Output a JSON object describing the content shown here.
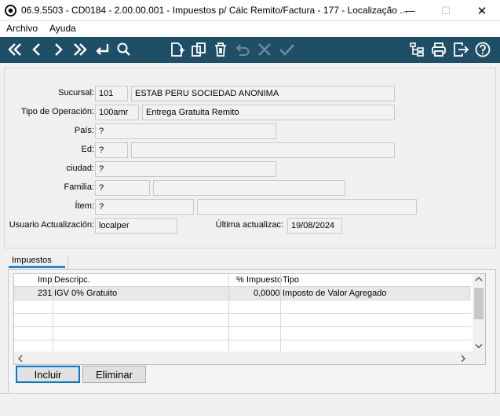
{
  "window": {
    "title": "06.9.5503 - CD0184 - 2.00.00.001 - Impuestos p/ Cálc Remito/Factura - 177 - Localização ...",
    "minimize": "—",
    "maximize": "☐",
    "close": "✕"
  },
  "menu": {
    "items": [
      "Archivo",
      "Ayuda"
    ]
  },
  "toolbar": {
    "left_icons": [
      "first-record-icon",
      "previous-record-icon",
      "next-record-icon",
      "last-record-icon",
      "return-icon",
      "search-icon"
    ],
    "mid_icons": [
      "new-record-icon",
      "copy-record-icon",
      "delete-icon",
      "undo-icon",
      "cancel-icon",
      "confirm-icon"
    ],
    "right_icons": [
      "tree-view-icon",
      "print-icon",
      "exit-icon",
      "help-icon"
    ]
  },
  "form": {
    "sucursal": {
      "label": "Sucursal:",
      "code": "101",
      "desc": "ESTAB PERU SOCIEDAD ANONIMA"
    },
    "tipo_operacion": {
      "label": "Tipo de Operación:",
      "code": "100amr",
      "desc": "Entrega Gratuita Remito"
    },
    "pais": {
      "label": "País:",
      "value": "?"
    },
    "ed": {
      "label": "Ed:",
      "code": "?",
      "desc": ""
    },
    "ciudad": {
      "label": "ciudad:",
      "value": "?"
    },
    "familia": {
      "label": "Familia:",
      "code": "?",
      "desc": ""
    },
    "item": {
      "label": "Ítem:",
      "code": "?",
      "desc": ""
    },
    "usuario": {
      "label": "Usuario Actualización:",
      "value": "localper"
    },
    "ultima": {
      "label": "Última actualizac:",
      "value": "19/08/2024"
    }
  },
  "tabs": {
    "impuestos": "Impuestos"
  },
  "grid": {
    "headers": [
      "Imp",
      "Descripc.",
      "% Impuesto",
      "Tipo"
    ],
    "rows": [
      {
        "imp": "231",
        "descripc": "IGV 0% Gratuito",
        "impuesto": "0,0000",
        "tipo": "Imposto de Valor Agregado"
      }
    ]
  },
  "buttons": {
    "incluir": "Incluir",
    "eliminar": "Eliminar"
  }
}
